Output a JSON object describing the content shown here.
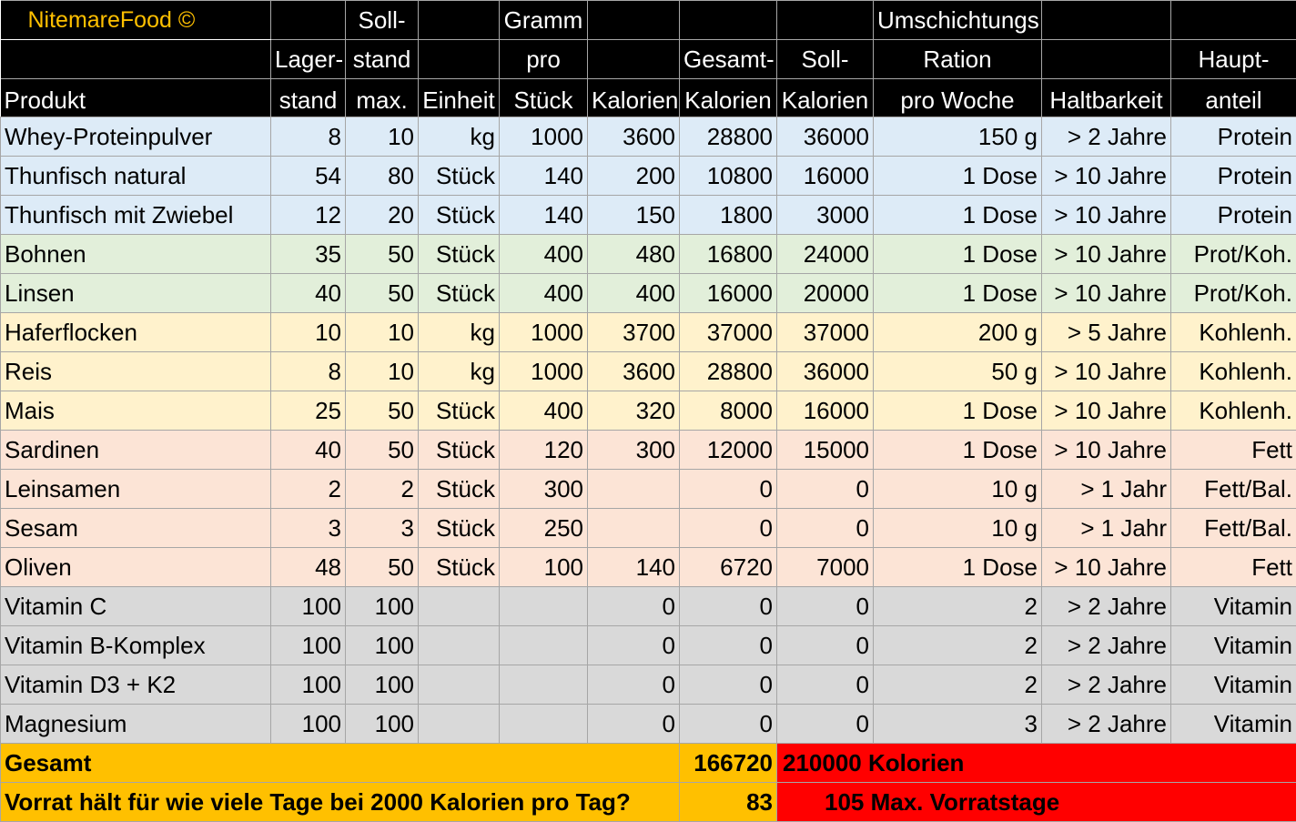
{
  "header": {
    "brand": "NitemareFood ©",
    "produkt": "Produkt",
    "lager": [
      "Lager-",
      "stand"
    ],
    "soll": [
      "Soll-",
      "stand",
      "max."
    ],
    "einheit": "Einheit",
    "gramm": [
      "Gramm",
      "pro",
      "Stück"
    ],
    "kalorien": "Kalorien",
    "gesamtkal": [
      "Gesamt-",
      "Kalorien"
    ],
    "sollkal": [
      "Soll-",
      "Kalorien"
    ],
    "umschicht": [
      "Umschichtungs",
      "Ration",
      "pro Woche"
    ],
    "haltbarkeit": "Haltbarkeit",
    "haupt": [
      "Haupt-",
      "anteil"
    ]
  },
  "rows": [
    {
      "c": "blue",
      "produkt": "Whey-Proteinpulver",
      "lager": "8",
      "soll": "10",
      "einheit": "kg",
      "gramm": "1000",
      "kalorien": "3600",
      "gesamt": "28800",
      "sollkal": "36000",
      "ration": "150 g",
      "haltbar": "> 2 Jahre",
      "haupt": "Protein"
    },
    {
      "c": "blue",
      "produkt": "Thunfisch natural",
      "lager": "54",
      "soll": "80",
      "einheit": "Stück",
      "gramm": "140",
      "kalorien": "200",
      "gesamt": "10800",
      "sollkal": "16000",
      "ration": "1 Dose",
      "haltbar": "> 10 Jahre",
      "haupt": "Protein"
    },
    {
      "c": "blue",
      "produkt": "Thunfisch mit Zwiebel",
      "lager": "12",
      "soll": "20",
      "einheit": "Stück",
      "gramm": "140",
      "kalorien": "150",
      "gesamt": "1800",
      "sollkal": "3000",
      "ration": "1 Dose",
      "haltbar": "> 10 Jahre",
      "haupt": "Protein"
    },
    {
      "c": "green",
      "produkt": "Bohnen",
      "lager": "35",
      "soll": "50",
      "einheit": "Stück",
      "gramm": "400",
      "kalorien": "480",
      "gesamt": "16800",
      "sollkal": "24000",
      "ration": "1 Dose",
      "haltbar": "> 10 Jahre",
      "haupt": "Prot/Koh."
    },
    {
      "c": "green",
      "produkt": "Linsen",
      "lager": "40",
      "soll": "50",
      "einheit": "Stück",
      "gramm": "400",
      "kalorien": "400",
      "gesamt": "16000",
      "sollkal": "20000",
      "ration": "1 Dose",
      "haltbar": "> 10 Jahre",
      "haupt": "Prot/Koh."
    },
    {
      "c": "yellow",
      "produkt": "Haferflocken",
      "lager": "10",
      "soll": "10",
      "einheit": "kg",
      "gramm": "1000",
      "kalorien": "3700",
      "gesamt": "37000",
      "sollkal": "37000",
      "ration": "200 g",
      "haltbar": "> 5 Jahre",
      "haupt": "Kohlenh."
    },
    {
      "c": "yellow",
      "produkt": "Reis",
      "lager": "8",
      "soll": "10",
      "einheit": "kg",
      "gramm": "1000",
      "kalorien": "3600",
      "gesamt": "28800",
      "sollkal": "36000",
      "ration": "50 g",
      "haltbar": "> 10 Jahre",
      "haupt": "Kohlenh."
    },
    {
      "c": "yellow",
      "produkt": "Mais",
      "lager": "25",
      "soll": "50",
      "einheit": "Stück",
      "gramm": "400",
      "kalorien": "320",
      "gesamt": "8000",
      "sollkal": "16000",
      "ration": "1 Dose",
      "haltbar": "> 10 Jahre",
      "haupt": "Kohlenh."
    },
    {
      "c": "red",
      "produkt": "Sardinen",
      "lager": "40",
      "soll": "50",
      "einheit": "Stück",
      "gramm": "120",
      "kalorien": "300",
      "gesamt": "12000",
      "sollkal": "15000",
      "ration": "1 Dose",
      "haltbar": "> 10 Jahre",
      "haupt": "Fett"
    },
    {
      "c": "red",
      "produkt": "Leinsamen",
      "lager": "2",
      "soll": "2",
      "einheit": "Stück",
      "gramm": "300",
      "kalorien": "",
      "gesamt": "0",
      "sollkal": "0",
      "ration": "10 g",
      "haltbar": "> 1 Jahr",
      "haupt": "Fett/Bal."
    },
    {
      "c": "red",
      "produkt": "Sesam",
      "lager": "3",
      "soll": "3",
      "einheit": "Stück",
      "gramm": "250",
      "kalorien": "",
      "gesamt": "0",
      "sollkal": "0",
      "ration": "10 g",
      "haltbar": "> 1 Jahr",
      "haupt": "Fett/Bal."
    },
    {
      "c": "red",
      "produkt": "Oliven",
      "lager": "48",
      "soll": "50",
      "einheit": "Stück",
      "gramm": "100",
      "kalorien": "140",
      "gesamt": "6720",
      "sollkal": "7000",
      "ration": "1 Dose",
      "haltbar": "> 10 Jahre",
      "haupt": "Fett"
    },
    {
      "c": "grey",
      "produkt": "Vitamin C",
      "lager": "100",
      "soll": "100",
      "einheit": "",
      "gramm": "",
      "kalorien": "0",
      "gesamt": "0",
      "sollkal": "0",
      "ration": "2",
      "haltbar": "> 2 Jahre",
      "haupt": "Vitamin"
    },
    {
      "c": "grey",
      "produkt": "Vitamin B-Komplex",
      "lager": "100",
      "soll": "100",
      "einheit": "",
      "gramm": "",
      "kalorien": "0",
      "gesamt": "0",
      "sollkal": "0",
      "ration": "2",
      "haltbar": "> 2 Jahre",
      "haupt": "Vitamin"
    },
    {
      "c": "grey",
      "produkt": "Vitamin D3 + K2",
      "lager": "100",
      "soll": "100",
      "einheit": "",
      "gramm": "",
      "kalorien": "0",
      "gesamt": "0",
      "sollkal": "0",
      "ration": "2",
      "haltbar": "> 2 Jahre",
      "haupt": "Vitamin"
    },
    {
      "c": "grey",
      "produkt": "Magnesium",
      "lager": "100",
      "soll": "100",
      "einheit": "",
      "gramm": "",
      "kalorien": "0",
      "gesamt": "0",
      "sollkal": "0",
      "ration": "3",
      "haltbar": "> 2 Jahre",
      "haupt": "Vitamin"
    }
  ],
  "totals": {
    "gesamt_label": "Gesamt",
    "gesamt_value": "166720",
    "soll_value": "210000 Kolorien",
    "question": "Vorrat hält für wie viele Tage bei 2000 Kalorien pro Tag?",
    "days_value": "83",
    "max_days": "105 Max. Vorratstage"
  },
  "colors": {
    "blue": "#ddebf7",
    "green": "#e2efda",
    "yellow": "#fff2cc",
    "red": "#fce4d6",
    "grey": "#d9d9d9",
    "total_orange": "#ffc000",
    "total_red": "#ff0000",
    "header_black": "#000000",
    "brand_yellow": "#ffc000"
  }
}
